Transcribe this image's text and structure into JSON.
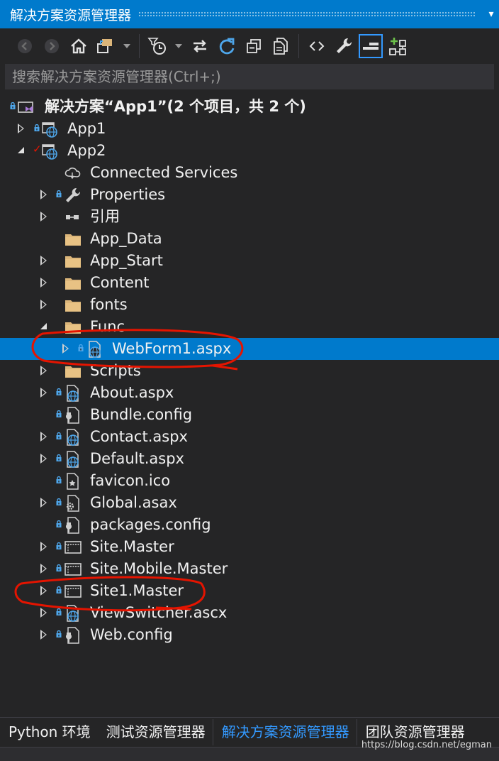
{
  "window": {
    "title": "解决方案资源管理器",
    "dropdown_glyph": "▾"
  },
  "toolbar": {
    "buttons": [
      {
        "name": "back-button",
        "icon": "arrow-left-icon"
      },
      {
        "name": "forward-button",
        "icon": "arrow-right-icon"
      },
      {
        "name": "home-button",
        "icon": "home-icon"
      },
      {
        "name": "switch-views-button",
        "icon": "switch-views-icon"
      },
      {
        "name": "pending-changes-filter-button",
        "icon": "clock-filter-icon"
      },
      {
        "name": "sync-active-document-button",
        "icon": "sync-arrows-icon"
      },
      {
        "name": "refresh-button",
        "icon": "refresh-icon"
      },
      {
        "name": "collapse-all-button",
        "icon": "collapse-all-icon"
      },
      {
        "name": "show-all-files-button",
        "icon": "copy-pages-icon"
      },
      {
        "name": "view-code-button",
        "icon": "code-brackets-icon"
      },
      {
        "name": "properties-button",
        "icon": "wrench-icon"
      },
      {
        "name": "preview-selected-items-button",
        "icon": "preview-icon"
      },
      {
        "name": "view-class-diagram-button",
        "icon": "class-diagram-icon"
      }
    ]
  },
  "search": {
    "placeholder": "搜索解决方案资源管理器(Ctrl+;)"
  },
  "tree": {
    "solution": {
      "label": "解决方案“App1”(2 个项目，共 2 个)"
    },
    "items": [
      {
        "label": "App1"
      },
      {
        "label": "App2"
      },
      {
        "label": "Connected Services"
      },
      {
        "label": "Properties"
      },
      {
        "label": "引用"
      },
      {
        "label": "App_Data"
      },
      {
        "label": "App_Start"
      },
      {
        "label": "Content"
      },
      {
        "label": "fonts"
      },
      {
        "label": "Func"
      },
      {
        "label": "WebForm1.aspx"
      },
      {
        "label": "Scripts"
      },
      {
        "label": "About.aspx"
      },
      {
        "label": "Bundle.config"
      },
      {
        "label": "Contact.aspx"
      },
      {
        "label": "Default.aspx"
      },
      {
        "label": "favicon.ico"
      },
      {
        "label": "Global.asax"
      },
      {
        "label": "packages.config"
      },
      {
        "label": "Site.Master"
      },
      {
        "label": "Site.Mobile.Master"
      },
      {
        "label": "Site1.Master"
      },
      {
        "label": "ViewSwitcher.ascx"
      },
      {
        "label": "Web.config"
      }
    ]
  },
  "bottom_tabs": [
    {
      "label": "Python 环境"
    },
    {
      "label": "测试资源管理器"
    },
    {
      "label": "解决方案资源管理器"
    },
    {
      "label": "团队资源管理器"
    }
  ],
  "watermark": "https://blog.csdn.net/egman",
  "colors": {
    "accent": "#007acc",
    "background": "#252526",
    "selection": "#007acc",
    "folder": "#dcb67a",
    "annotation": "#e51400"
  }
}
